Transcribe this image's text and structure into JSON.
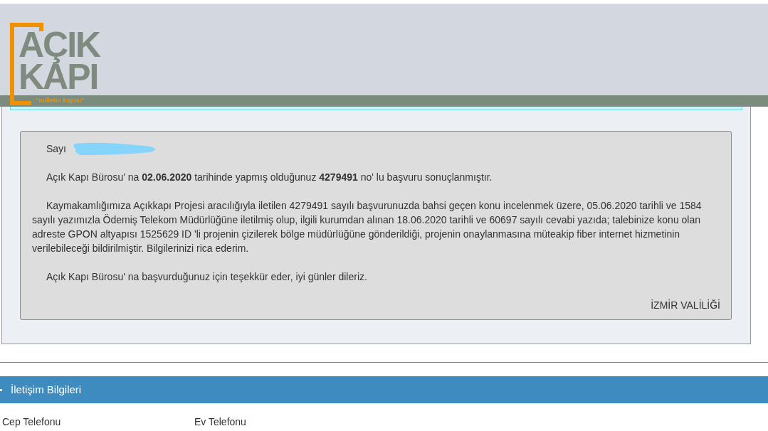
{
  "logo": {
    "line_1": "AÇIK",
    "line_2": "KAPI",
    "tagline": "“milletin kapısı”"
  },
  "message": {
    "greeting": "Sayı",
    "paragraphs": [
      "Açık Kapı Bürosu' na **02.06.2020** tarihinde yapmış olduğunuz **4279491** no' lu başvuru sonuçlanmıştır.",
      "Kaymakamlığımıza Açıkkapı Projesi aracılığıyla iletilen 4279491 sayılı başvurunuzda bahsi geçen konu incelenmek üzere, 05.06.2020 tarihli ve 1584 sayılı yazımızla Ödemiş Telekom Müdürlüğüne iletilmiş olup, ilgili kurumdan alınan 18.06.2020 tarihli ve 60697 sayılı cevabi yazıda; talebinize konu olan adreste GPON altyapısı 1525629 ID 'li projenin çizilerek bölge müdürlüğüne gönderildiği, projenin onaylanmasına müteakip fiber internet hizmetinin verilebileceği bildirilmiştir. Bilgilerinizi rica ederim.",
      "Açık Kapı Bürosu' na başvurduğunuz için teşekkür eder, iyi günler dileriz."
    ],
    "signature": "İZMİR VALİLİĞİ"
  },
  "contact_section": {
    "title": "İletişim Bilgileri",
    "fields": [
      "Cep Telefonu",
      "Ev Telefonu"
    ]
  }
}
